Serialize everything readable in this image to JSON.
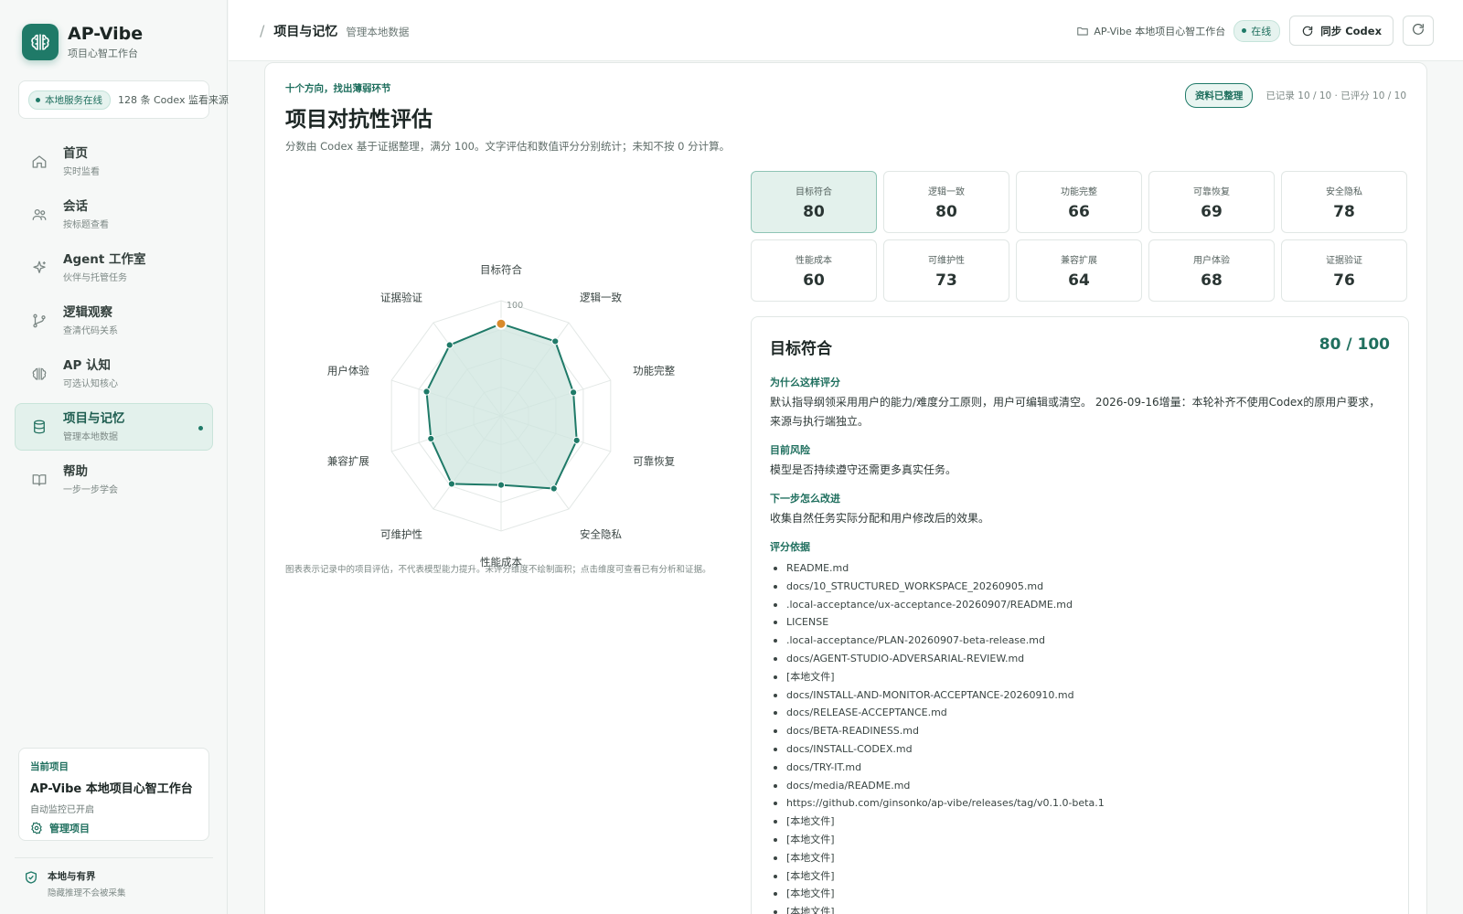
{
  "brand": {
    "title": "AP-Vibe",
    "subtitle": "项目心智工作台"
  },
  "service": {
    "status": "本地服务在线",
    "count": "128 条 Codex 监看来源"
  },
  "nav": [
    {
      "label": "首页",
      "sub": "实时监看",
      "icon": "home-icon"
    },
    {
      "label": "会话",
      "sub": "按标题查看",
      "icon": "users-icon"
    },
    {
      "label": "Agent 工作室",
      "sub": "伙伴与托管任务",
      "icon": "sparkle-icon"
    },
    {
      "label": "逻辑观察",
      "sub": "查清代码关系",
      "icon": "branch-icon"
    },
    {
      "label": "AP 认知",
      "sub": "可选认知核心",
      "icon": "brain-icon"
    },
    {
      "label": "项目与记忆",
      "sub": "管理本地数据",
      "icon": "database-icon",
      "active": true
    },
    {
      "label": "帮助",
      "sub": "一步一步学会",
      "icon": "book-icon"
    }
  ],
  "current_project": {
    "key": "当前项目",
    "name": "AP-Vibe 本地项目心智工作台",
    "auto": "自动监控已开启",
    "manage": "管理项目"
  },
  "boundary": {
    "title": "本地与有界",
    "sub": "隐藏推理不会被采集"
  },
  "topbar": {
    "slash": "/",
    "title": "项目与记忆",
    "subtitle": "管理本地数据",
    "workspace": "AP-Vibe 本地项目心智工作台",
    "online": "在线",
    "sync": "同步 Codex"
  },
  "main": {
    "eyebrow": "十个方向，找出薄弱环节",
    "title": "项目对抗性评估",
    "desc": "分数由 Codex 基于证据整理，满分 100。文字评估和数值评分分别统计；未知不按 0 分计算。",
    "badge": "资料已整理",
    "recorded": "已记录 10 / 10 · 已评分 10 / 10",
    "radar_note": "图表表示记录中的项目评估，不代表模型能力提升。未评分维度不绘制面积；点击维度可查看已有分析和证据。"
  },
  "chart_data": {
    "type": "radar",
    "categories": [
      "目标符合",
      "逻辑一致",
      "功能完整",
      "可靠恢复",
      "安全隐私",
      "性能成本",
      "可维护性",
      "兼容扩展",
      "用户体验",
      "证据验证"
    ],
    "values": [
      80,
      80,
      66,
      69,
      78,
      60,
      73,
      64,
      68,
      76
    ],
    "max_label": "100",
    "range": [
      0,
      100
    ],
    "highlight_index": 0,
    "colors": {
      "line": "#1f7a68",
      "fill": "#cfe6df",
      "highlight": "#d98a2b",
      "grid": "#e3e8e6"
    }
  },
  "scores": [
    {
      "label": "目标符合",
      "value": "80",
      "active": true
    },
    {
      "label": "逻辑一致",
      "value": "80"
    },
    {
      "label": "功能完整",
      "value": "66"
    },
    {
      "label": "可靠恢复",
      "value": "69"
    },
    {
      "label": "安全隐私",
      "value": "78"
    },
    {
      "label": "性能成本",
      "value": "60"
    },
    {
      "label": "可维护性",
      "value": "73"
    },
    {
      "label": "兼容扩展",
      "value": "64"
    },
    {
      "label": "用户体验",
      "value": "68"
    },
    {
      "label": "证据验证",
      "value": "76"
    }
  ],
  "detail": {
    "title": "目标符合",
    "score": "80 / 100",
    "why_k": "为什么这样评分",
    "why_v": "默认指导纲领采用用户的能力/难度分工原则，用户可编辑或清空。 2026-09-16增量：本轮补齐不使用Codex的原用户要求，来源与执行端独立。",
    "risk_k": "目前风险",
    "risk_v": "模型是否持续遵守还需更多真实任务。",
    "next_k": "下一步怎么改进",
    "next_v": "收集自然任务实际分配和用户修改后的效果。",
    "evidence_k": "评分依据",
    "evidence": [
      "README.md",
      "docs/10_STRUCTURED_WORKSPACE_20260905.md",
      ".local-acceptance/ux-acceptance-20260907/README.md",
      "LICENSE",
      ".local-acceptance/PLAN-20260907-beta-release.md",
      "docs/AGENT-STUDIO-ADVERSARIAL-REVIEW.md",
      "[本地文件]",
      "docs/INSTALL-AND-MONITOR-ACCEPTANCE-20260910.md",
      "docs/RELEASE-ACCEPTANCE.md",
      "docs/BETA-READINESS.md",
      "docs/INSTALL-CODEX.md",
      "docs/TRY-IT.md",
      "docs/media/README.md",
      "https://github.com/ginsonko/ap-vibe/releases/tag/v0.1.0-beta.1",
      "[本地文件]",
      "[本地文件]",
      "[本地文件]",
      "[本地文件]",
      "[本地文件]",
      "[本地文件]"
    ]
  }
}
